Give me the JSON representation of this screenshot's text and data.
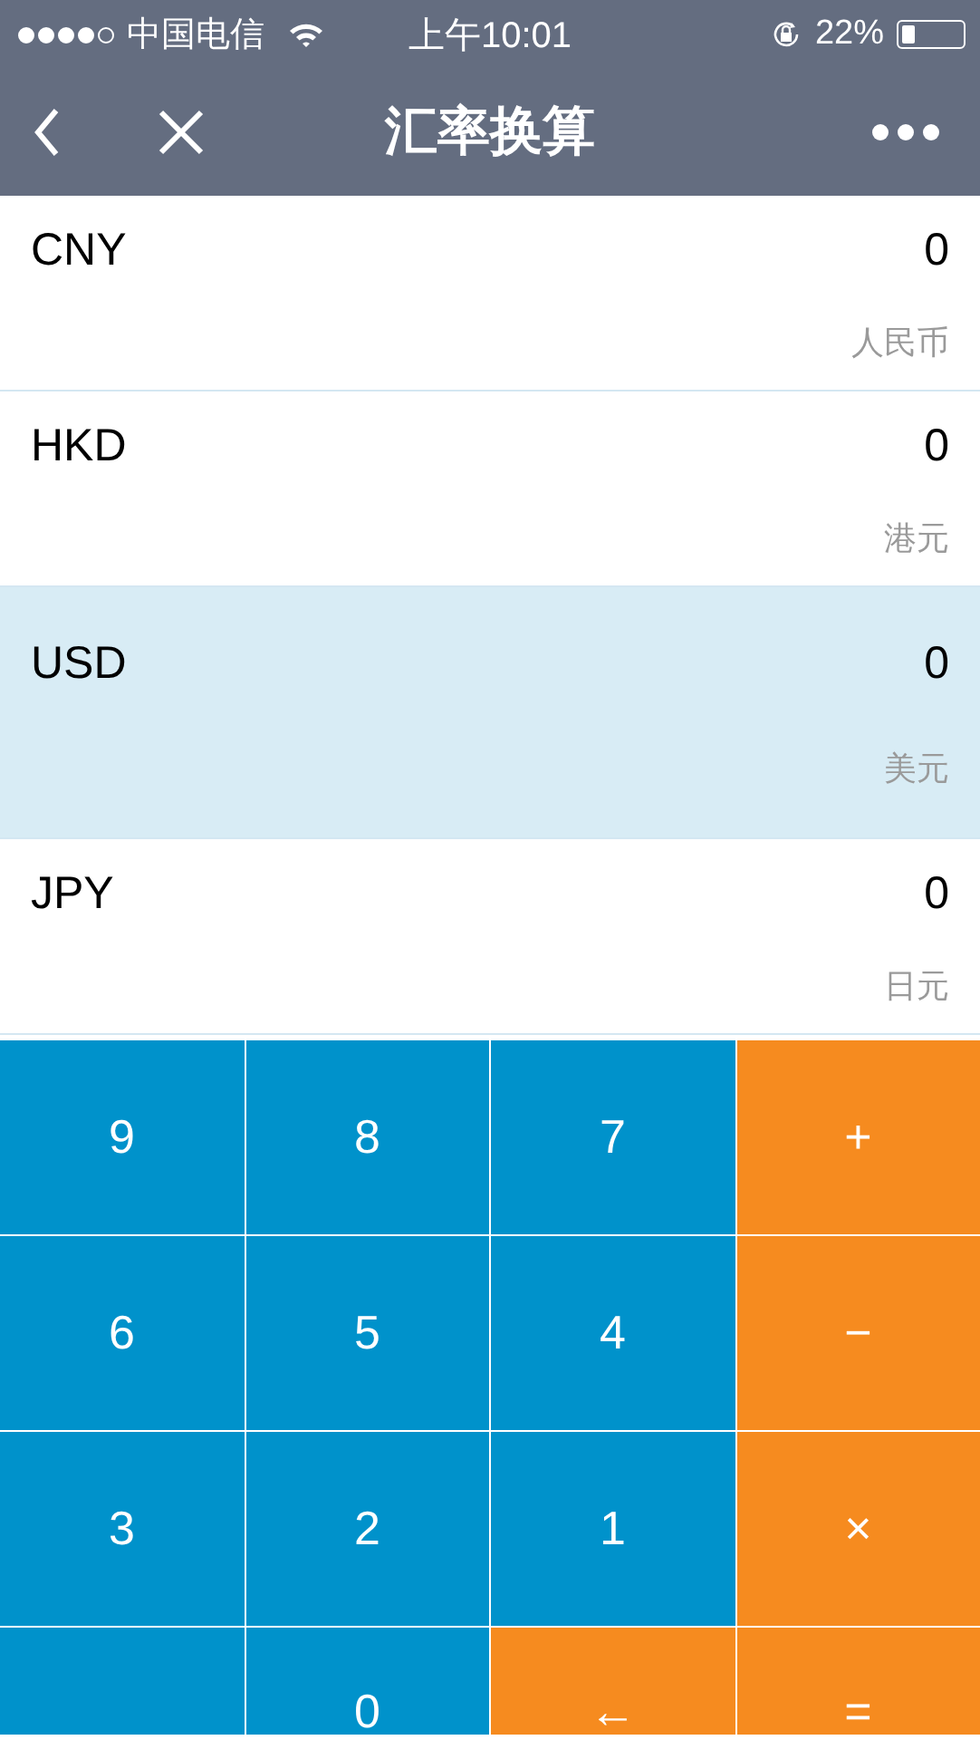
{
  "status_bar": {
    "carrier": "中国电信",
    "time": "上午10:01",
    "battery": "22%"
  },
  "nav": {
    "title": "汇率换算"
  },
  "currencies": [
    {
      "code": "CNY",
      "amount": "0",
      "name": "人民币",
      "selected": false
    },
    {
      "code": "HKD",
      "amount": "0",
      "name": "港元",
      "selected": false
    },
    {
      "code": "USD",
      "amount": "0",
      "name": "美元",
      "selected": true
    },
    {
      "code": "JPY",
      "amount": "0",
      "name": "日元",
      "selected": false
    }
  ],
  "keypad": [
    {
      "kind": "number",
      "label": "9"
    },
    {
      "kind": "number",
      "label": "8"
    },
    {
      "kind": "number",
      "label": "7"
    },
    {
      "kind": "operator",
      "label": "+"
    },
    {
      "kind": "number",
      "label": "6"
    },
    {
      "kind": "number",
      "label": "5"
    },
    {
      "kind": "number",
      "label": "4"
    },
    {
      "kind": "operator",
      "label": "−"
    },
    {
      "kind": "number",
      "label": "3"
    },
    {
      "kind": "number",
      "label": "2"
    },
    {
      "kind": "number",
      "label": "1"
    },
    {
      "kind": "operator",
      "label": "×"
    },
    {
      "kind": "blank"
    },
    {
      "kind": "number",
      "label": "0"
    },
    {
      "kind": "operator",
      "label": "←"
    },
    {
      "kind": "operator",
      "label": "="
    }
  ]
}
